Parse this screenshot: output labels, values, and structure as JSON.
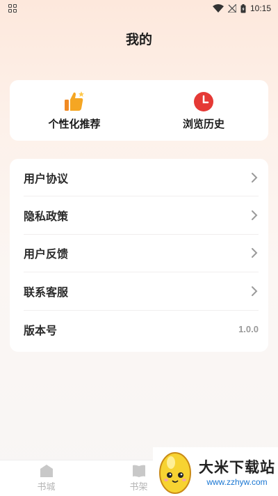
{
  "status_bar": {
    "time": "10:15"
  },
  "page": {
    "title": "我的"
  },
  "shortcuts": [
    {
      "label": "个性化推荐",
      "icon": "thumbs-up-icon"
    },
    {
      "label": "浏览历史",
      "icon": "clock-icon"
    }
  ],
  "menu": {
    "items": [
      {
        "label": "用户协议"
      },
      {
        "label": "隐私政策"
      },
      {
        "label": "用户反馈"
      },
      {
        "label": "联系客服"
      }
    ],
    "version_label": "版本号",
    "version_value": "1.0.0"
  },
  "tabs": [
    {
      "label": "书城",
      "icon": "home-icon"
    },
    {
      "label": "书架",
      "icon": "book-icon"
    }
  ],
  "watermark": {
    "title": "大米下载站",
    "url": "www.zzhyw.com"
  },
  "colors": {
    "accent": "#f08a24",
    "clock_red": "#e53935",
    "tab_inactive": "#b5b5b5"
  }
}
